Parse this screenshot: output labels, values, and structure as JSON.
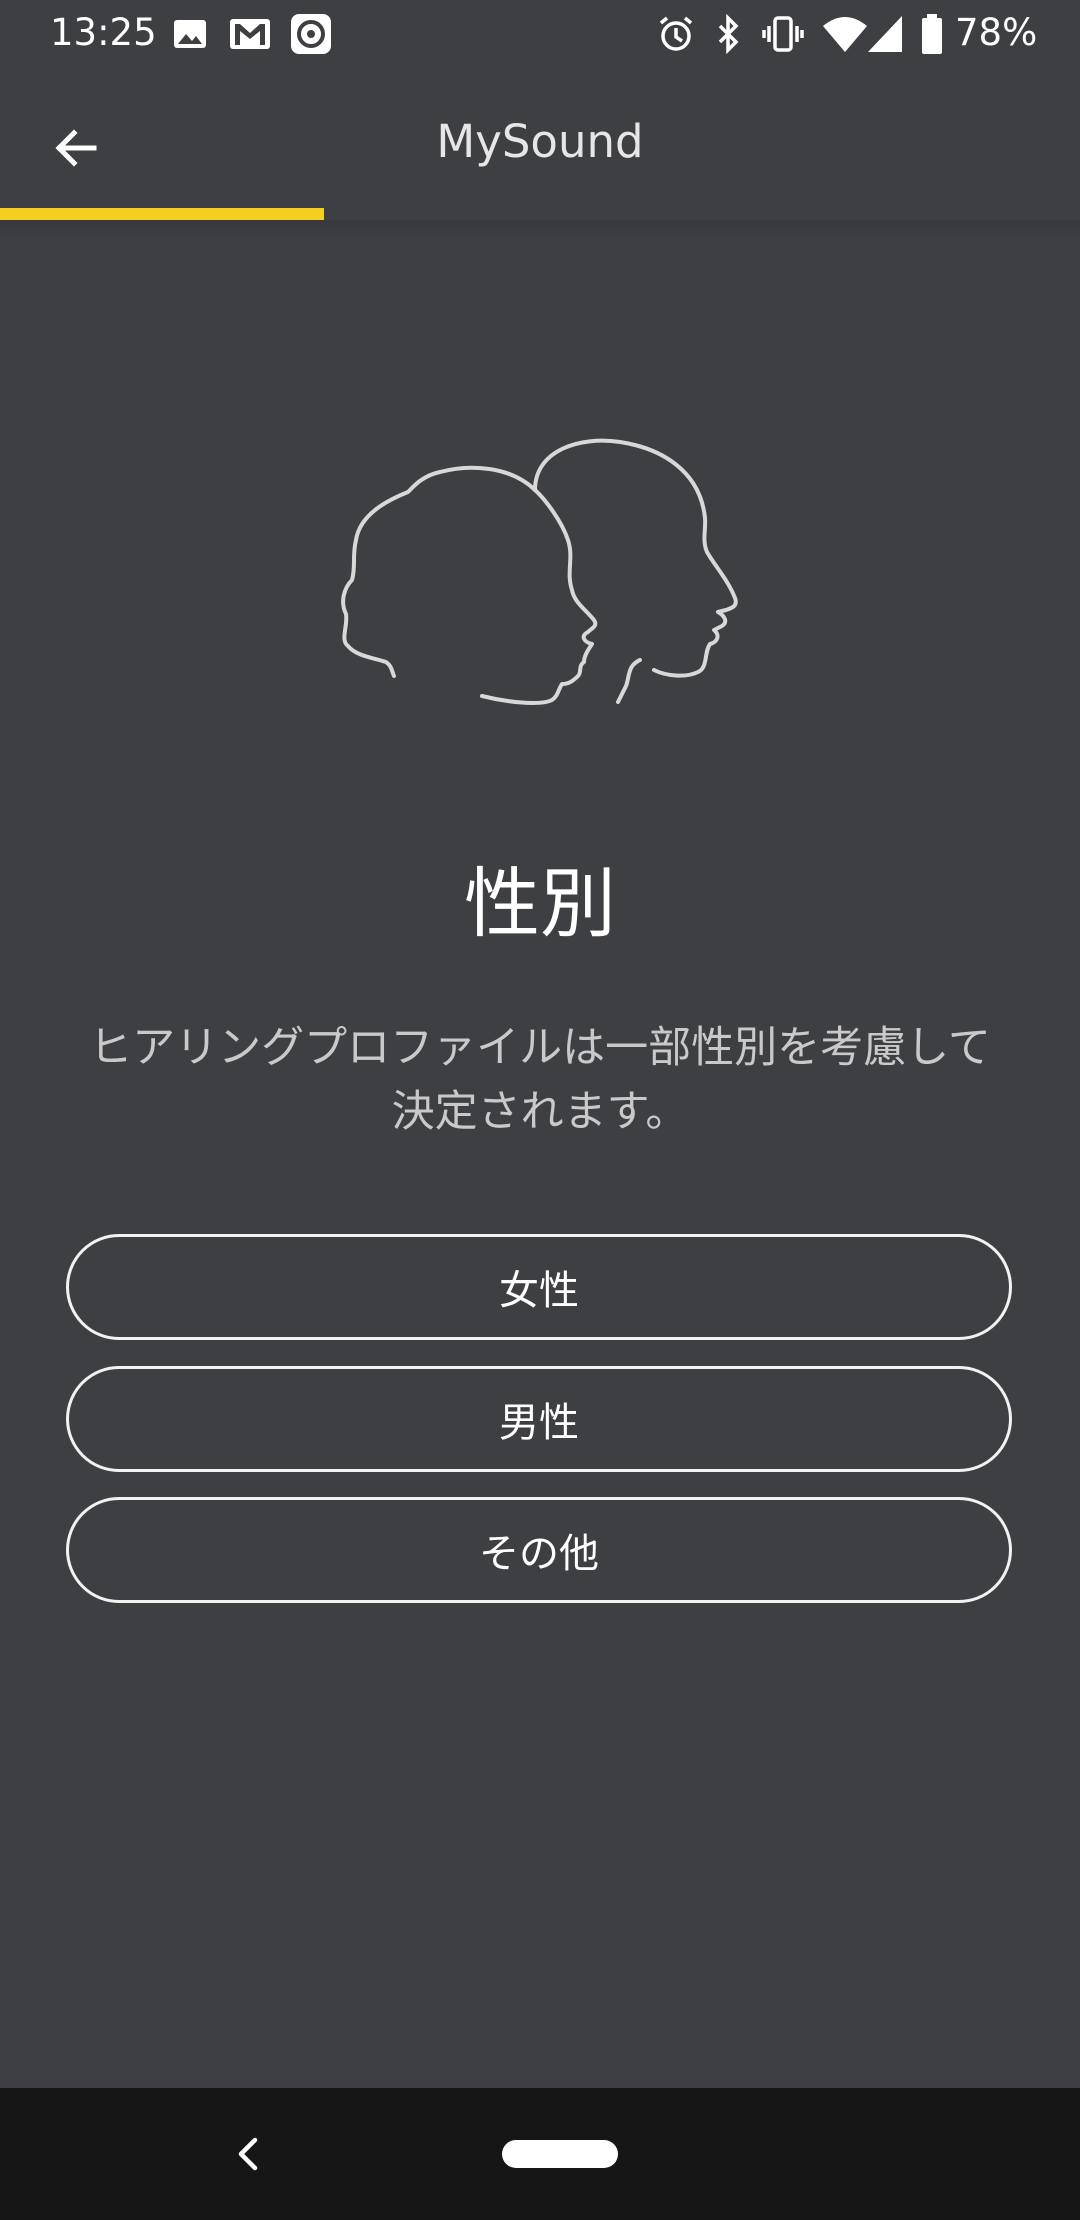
{
  "status_bar": {
    "time": "13:25",
    "battery_percent": "78%",
    "icons": [
      "image-icon",
      "gmail-icon",
      "app-icon",
      "alarm-icon",
      "bluetooth-icon",
      "vibrate-icon",
      "wifi-icon",
      "signal-icon",
      "battery-icon"
    ]
  },
  "app_bar": {
    "title": "MySound",
    "back_icon": "arrow-left-icon",
    "progress": 0.3
  },
  "content": {
    "illustration_icon": "two-heads-profile-icon",
    "heading": "性別",
    "description": "ヒアリングプロファイルは一部性別を考慮して決定されます。",
    "options": [
      "女性",
      "男性",
      "その他"
    ]
  },
  "nav_bar": {
    "back_icon": "nav-back-icon",
    "home_icon": "home-pill-icon"
  },
  "colors": {
    "background": "#3e3f43",
    "accent": "#f5cf1f",
    "nav_background": "#161616"
  }
}
